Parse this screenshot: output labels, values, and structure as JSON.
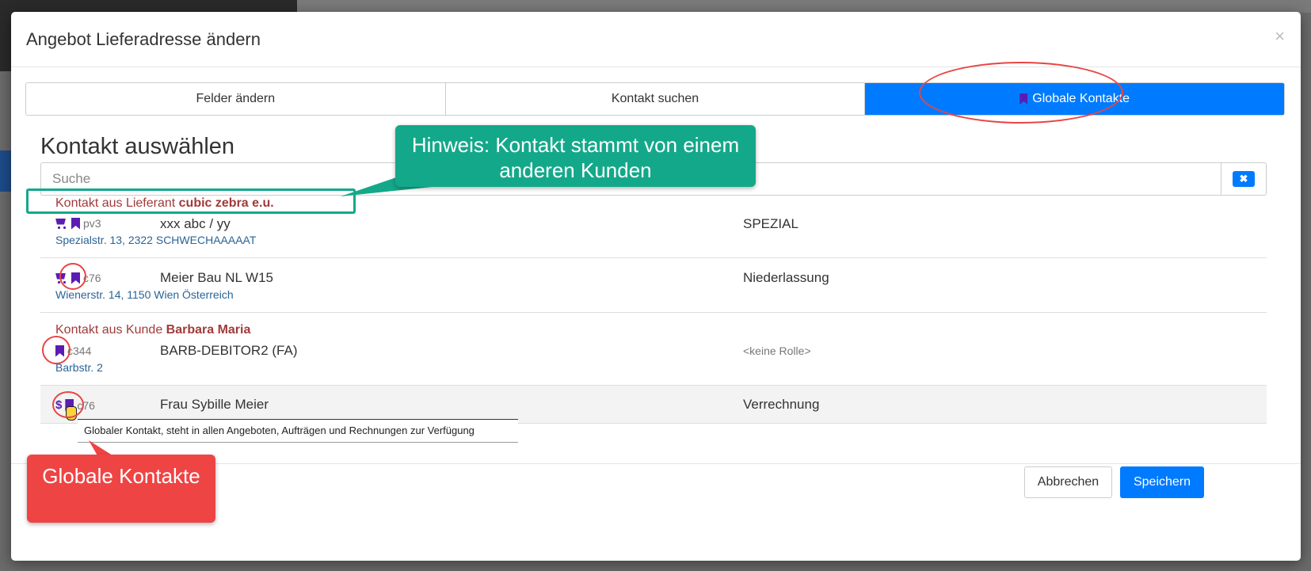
{
  "dialog": {
    "title": "Angebot Lieferadresse ändern",
    "close_symbol": "×"
  },
  "tabs": [
    {
      "label": "Felder ändern",
      "active": false
    },
    {
      "label": "Kontakt suchen",
      "active": false
    },
    {
      "label": "Globale Kontakte",
      "active": true,
      "icon": "bookmark-icon"
    }
  ],
  "section_title": "Kontakt auswählen",
  "search": {
    "placeholder": "Suche",
    "value": "",
    "clear_icon": "✖"
  },
  "groups": [
    {
      "prefix": "Kontakt aus Lieferant ",
      "name": "cubic zebra e.u.",
      "contacts": [
        {
          "icons": [
            "cart-icon",
            "bookmark-icon"
          ],
          "code": "pv3",
          "name": "xxx abc / yy",
          "address": "Spezialstr. 13, 2322 SCHWECHAAAAAT",
          "role": "SPEZIAL"
        },
        {
          "icons": [
            "cart-icon",
            "bookmark-icon"
          ],
          "code": "c76",
          "name": "Meier Bau NL W15",
          "address": "Wienerstr. 14, 1150 Wien Österreich",
          "role": "Niederlassung"
        }
      ]
    },
    {
      "prefix": "Kontakt aus Kunde ",
      "name": "Barbara Maria",
      "contacts": [
        {
          "icons": [
            "bookmark-icon"
          ],
          "code": "c344",
          "name": "BARB-DEBITOR2 (FA)",
          "address": "Barbstr. 2",
          "role": "<keine Rolle>"
        },
        {
          "icons": [
            "dollar-icon",
            "bookmark-icon"
          ],
          "code": "c76",
          "name": "Frau Sybille Meier",
          "address": "",
          "role": "Verrechnung"
        }
      ]
    }
  ],
  "tooltip": "Globaler Kontakt, steht in allen Angeboten, Aufträgen und Rechnungen zur Verfügung",
  "footer": {
    "cancel_label": "Abbrechen",
    "save_label": "Speichern"
  },
  "annotations": {
    "hint": "Hinweis: Kontakt stammt von einem anderen Kunden",
    "global": "Globale Kontakte"
  },
  "colors": {
    "primary": "#007bff",
    "icon_purple": "#5b1cb3",
    "group_header_red": "#a13a3a",
    "address_blue": "#2a6496",
    "callout_green": "#14a88a",
    "callout_red": "#ef4444"
  }
}
